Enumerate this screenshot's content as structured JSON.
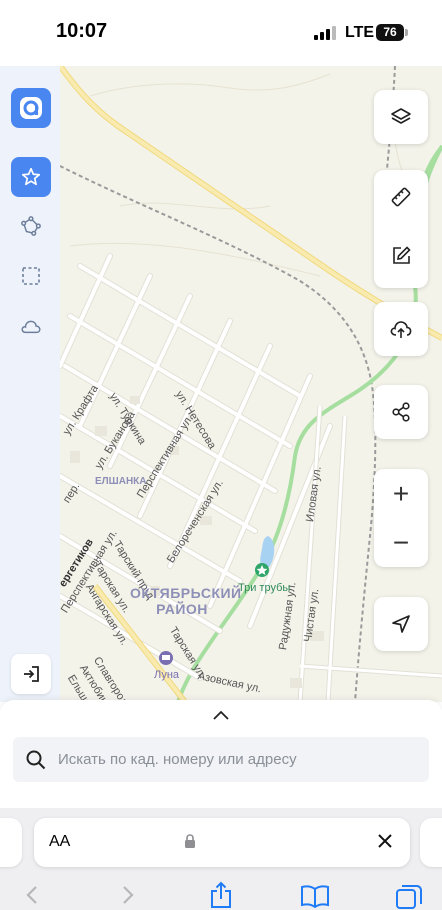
{
  "status_bar": {
    "time": "10:07",
    "network": "LTE",
    "battery": "76"
  },
  "map": {
    "streets": [
      {
        "text": "ул. Крафта"
      },
      {
        "text": "ул. Туркина"
      },
      {
        "text": "ул. Нетесова"
      },
      {
        "text": "ул. Буканова"
      },
      {
        "text": "Перспективная ул."
      },
      {
        "text": "Перспективная ул."
      },
      {
        "text": "пер."
      },
      {
        "text": "Тарский пр-д"
      },
      {
        "text": "Тарская ул."
      },
      {
        "text": "Ангарская ул."
      },
      {
        "text": "Белореченская ул."
      },
      {
        "text": "Иловая ул."
      },
      {
        "text": "Радужная ул."
      },
      {
        "text": "Чистая ул."
      },
      {
        "text": "Тарская ул."
      },
      {
        "text": "Славгородская ул."
      },
      {
        "text": "Актюбинская ул."
      },
      {
        "text": "Ельшанская"
      },
      {
        "text": "Азовская ул."
      },
      {
        "text": "ергетиков"
      }
    ],
    "district": "ОКТЯБРЬСКИЙ РАЙОН",
    "neighborhood": "ЕЛШАНКА",
    "poi_park": "Три трубы",
    "poi_hotel": "Луна"
  },
  "sidebar": {
    "items": [
      {
        "icon": "app-logo-icon"
      },
      {
        "icon": "star-icon"
      },
      {
        "icon": "polygon-draw-icon"
      },
      {
        "icon": "select-area-icon"
      },
      {
        "icon": "cloud-icon"
      },
      {
        "icon": "exit-icon"
      }
    ]
  },
  "controls": {
    "zoom_in": "+",
    "zoom_out": "−"
  },
  "bottom_sheet": {
    "search_placeholder": "Искать по кад. номеру или адресу"
  },
  "safari": {
    "text_size": "AA",
    "colors": {
      "bar": "#efeff2",
      "accent": "#1f7cf6"
    }
  },
  "colors": {
    "primary": "#4a86f0",
    "map_bg": "#f4f3ea",
    "road_major": "#f7e59a",
    "railway": "#9a9a9a",
    "water": "#a8d2f2",
    "green_line": "#a6dea0"
  }
}
